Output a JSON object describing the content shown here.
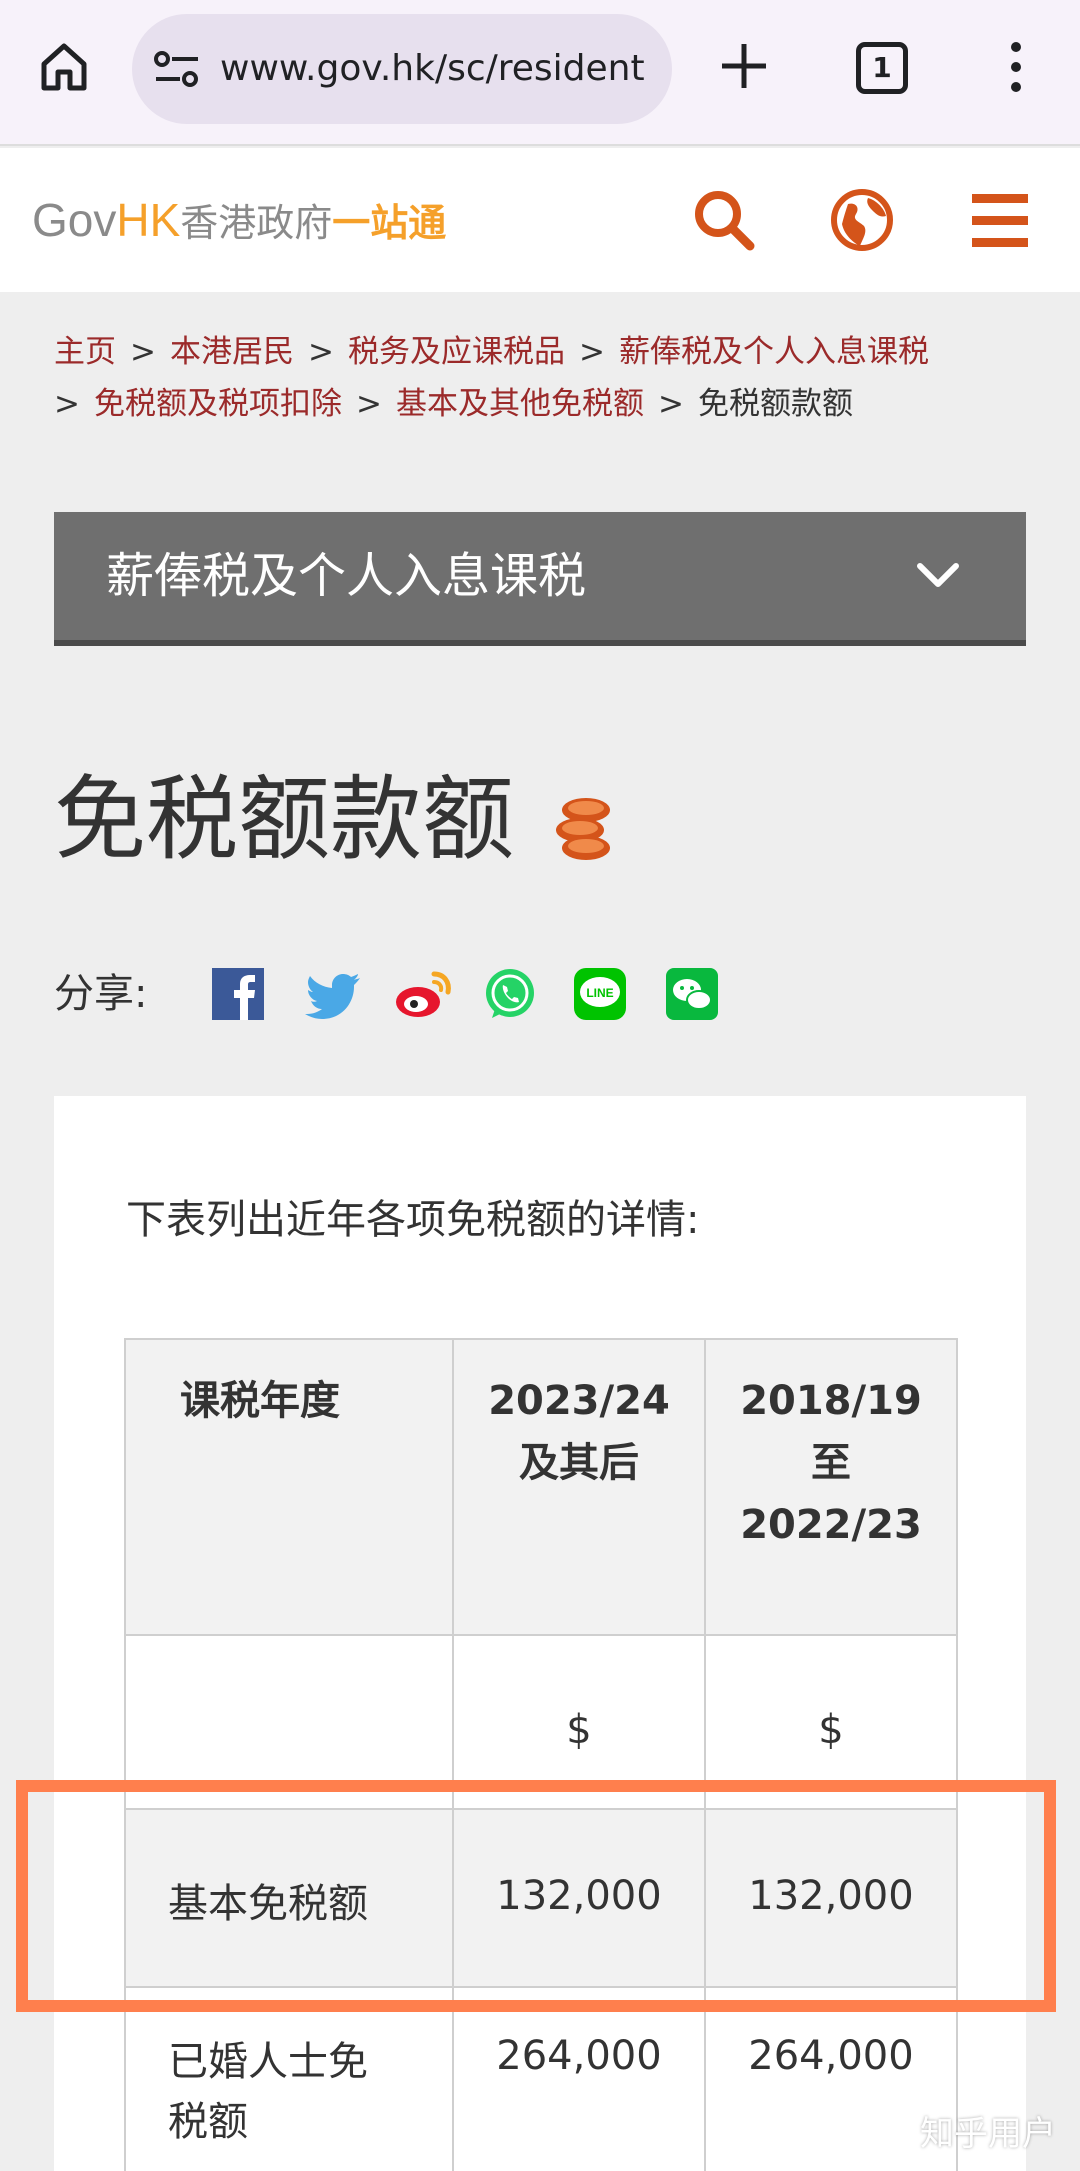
{
  "browser": {
    "url": "www.gov.hk/sc/resident",
    "tab_count": "1"
  },
  "header": {
    "logo_gov": "Gov",
    "logo_hk": "HK",
    "logo_cn_gray": "香港政府",
    "logo_cn_orange": "一站通"
  },
  "breadcrumb": {
    "items": [
      "主页",
      "本港居民",
      "税务及应课税品",
      "薪俸税及个人入息课税",
      "免税额及税项扣除",
      "基本及其他免税额"
    ],
    "current": "免税额款额",
    "separator": ">"
  },
  "section_dropdown": {
    "title": "薪俸税及个人入息课税"
  },
  "page": {
    "title": "免税额款额",
    "share_label": "分享:",
    "intro": "下表列出近年各项免税额的详情:"
  },
  "table": {
    "headers": [
      "课税年度",
      "2023/24\n及其后",
      "2018/19\n至\n2022/23"
    ],
    "header_lines": {
      "col1": [
        "课税年度"
      ],
      "col2": [
        "2023/24",
        "及其后"
      ],
      "col3": [
        "2018/19",
        "至",
        "2022/23"
      ]
    },
    "currency_row": [
      "",
      "$",
      "$"
    ],
    "rows": [
      {
        "label": "基本免税额",
        "v2023": "132,000",
        "v2018": "132,000"
      },
      {
        "label_lines": [
          "已婚人士免",
          "税额"
        ],
        "v2023": "264,000",
        "v2018": "264,000"
      }
    ]
  },
  "watermark": "知乎用户",
  "colors": {
    "accent_orange": "#f5a02a",
    "icon_orange": "#d4541a",
    "breadcrumb_link": "#9b2a2a",
    "highlight": "#ff7f4d"
  }
}
